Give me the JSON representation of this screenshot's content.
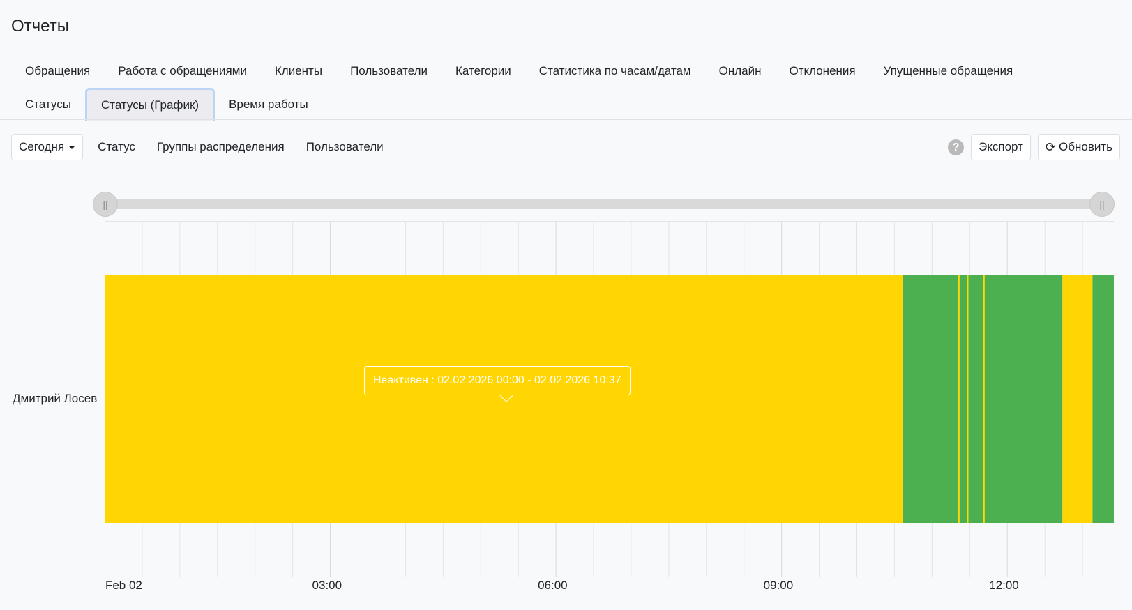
{
  "page": {
    "title": "Отчеты"
  },
  "tabs": {
    "row1": [
      "Обращения",
      "Работа с обращениями",
      "Клиенты",
      "Пользователи",
      "Категории",
      "Статистика по часам/датам",
      "Онлайн",
      "Отклонения",
      "Упущенные обращения"
    ],
    "row2": [
      "Статусы",
      "Статусы (График)",
      "Время работы"
    ],
    "active": "Статусы (График)"
  },
  "toolbar": {
    "period_label": "Сегодня",
    "filter_status": "Статус",
    "filter_groups": "Группы распределения",
    "filter_users": "Пользователи",
    "help_symbol": "?",
    "export_label": "Экспорт",
    "refresh_symbol": "⟳",
    "refresh_label": "Обновить"
  },
  "slider": {
    "start_fraction": 0.0,
    "end_fraction": 1.0
  },
  "chart_data": {
    "type": "timeline",
    "x_range": [
      "00:00",
      "13:25"
    ],
    "x_tick_labels": [
      {
        "label": "Feb 02",
        "hour": 0.25
      },
      {
        "label": "03:00",
        "hour": 3
      },
      {
        "label": "06:00",
        "hour": 6
      },
      {
        "label": "09:00",
        "hour": 9
      },
      {
        "label": "12:00",
        "hour": 12
      }
    ],
    "rows": [
      {
        "name": "Дмитрий Лосев",
        "segments": [
          {
            "status": "Неактивен",
            "start": "00:00",
            "end": "10:37",
            "color": "#ffd502"
          },
          {
            "status": "active",
            "start": "10:37",
            "end": "11:21",
            "color": "#4caf50"
          },
          {
            "status": "Неактивен",
            "start": "11:21",
            "end": "11:22",
            "color": "#ffd502"
          },
          {
            "status": "active",
            "start": "11:22",
            "end": "11:28",
            "color": "#4caf50"
          },
          {
            "status": "Неактивен",
            "start": "11:28",
            "end": "11:29",
            "color": "#ffd502"
          },
          {
            "status": "active",
            "start": "11:29",
            "end": "11:41",
            "color": "#4caf50"
          },
          {
            "status": "Неактивен",
            "start": "11:41",
            "end": "11:42",
            "color": "#ffd502"
          },
          {
            "status": "active",
            "start": "11:42",
            "end": "12:44",
            "color": "#4caf50"
          },
          {
            "status": "Неактивен",
            "start": "12:44",
            "end": "13:08",
            "color": "#ffd502"
          },
          {
            "status": "active",
            "start": "13:08",
            "end": "13:25",
            "color": "#4caf50"
          }
        ]
      }
    ],
    "tooltip": "Неактивен : 02.02.2026 00:00 - 02.02.2026 10:37"
  },
  "colors": {
    "inactive": "#ffd502",
    "active": "#4caf50",
    "grid": "#e2e4e8"
  }
}
